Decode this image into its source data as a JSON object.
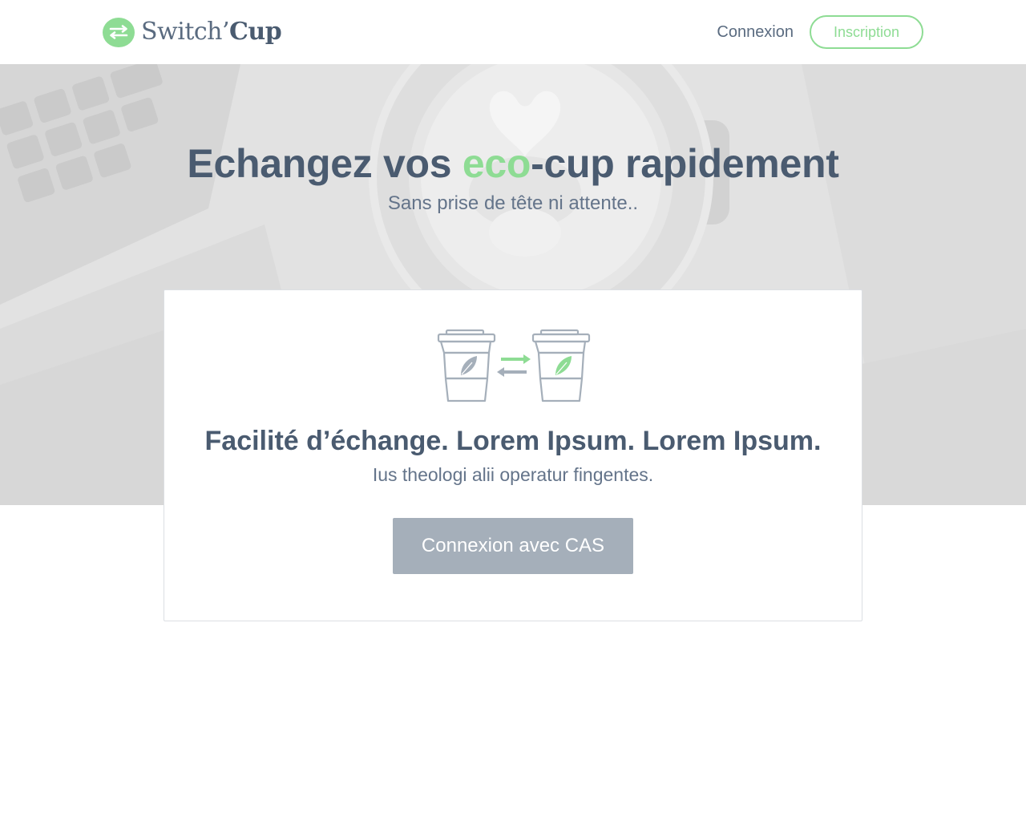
{
  "header": {
    "logo": {
      "icon": "swap-arrows-icon",
      "name_light": "Switch’",
      "name_bold": "Cup",
      "color": "#8edc94"
    },
    "nav": {
      "login_label": "Connexion",
      "signup_label": "Inscription"
    }
  },
  "hero": {
    "title_part1": "Echangez vos ",
    "title_accent": "eco",
    "title_bold": "-cup",
    "title_part2": " rapidement",
    "subtitle": "Sans prise de tête ni attente.."
  },
  "card": {
    "illustration": "eco-cups-exchange-icon",
    "title": "Facilité d’échange. Lorem Ipsum. Lorem Ipsum.",
    "subtitle": "Ius theologi alii operatur fingentes.",
    "cas_button_label": "Connexion avec CAS"
  },
  "colors": {
    "accent": "#8edc94",
    "text": "#4a5b70",
    "button": "#a5afba"
  }
}
